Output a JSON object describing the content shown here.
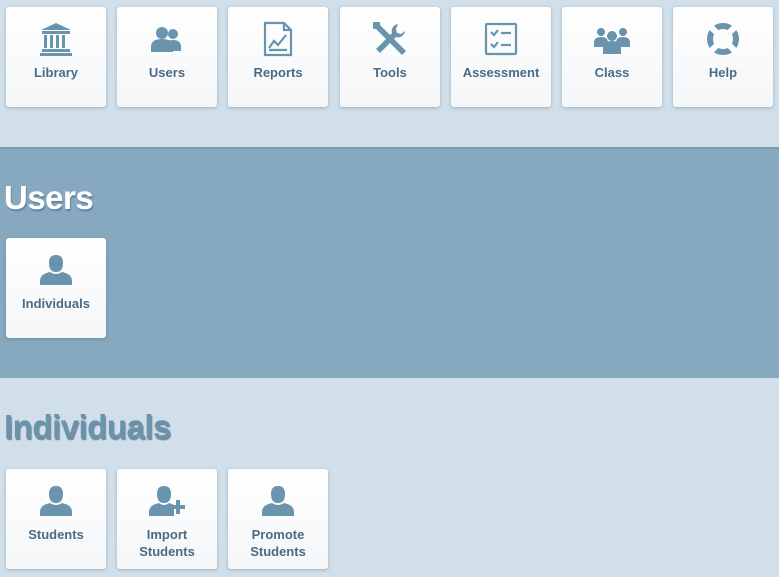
{
  "nav": {
    "items": [
      {
        "label": "Library",
        "icon": "library-icon"
      },
      {
        "label": "Users",
        "icon": "users-icon"
      },
      {
        "label": "Reports",
        "icon": "reports-icon"
      },
      {
        "label": "Tools",
        "icon": "tools-icon"
      },
      {
        "label": "Assessment",
        "icon": "assessment-icon"
      },
      {
        "label": "Class",
        "icon": "class-icon"
      },
      {
        "label": "Help",
        "icon": "help-icon"
      }
    ]
  },
  "users_section": {
    "title": "Users",
    "items": [
      {
        "label": "Individuals",
        "icon": "person-icon"
      }
    ]
  },
  "individuals_section": {
    "title": "Individuals",
    "items": [
      {
        "label": "Students",
        "icon": "person-icon"
      },
      {
        "label": "Import Students",
        "icon": "person-add-icon"
      },
      {
        "label": "Promote Students",
        "icon": "person-icon"
      }
    ]
  },
  "colors": {
    "icon": "#6a93ad",
    "label": "#4a6b85",
    "band": "#86a9bf",
    "background": "#d0dfea"
  }
}
